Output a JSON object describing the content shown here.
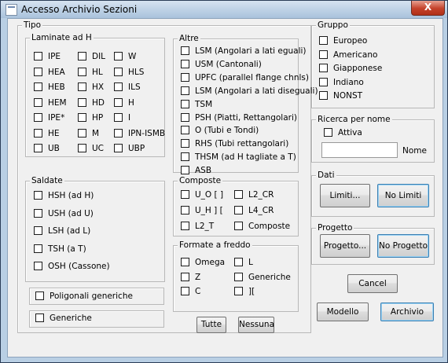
{
  "window": {
    "title": "Accesso Archivio Sezioni",
    "close": "X"
  },
  "tipo": {
    "label": "Tipo",
    "laminate": {
      "label": "Laminate ad H",
      "items": [
        "IPE",
        "DIL",
        "W",
        "HEA",
        "HL",
        "HLS",
        "HEB",
        "HX",
        "ILS",
        "HEM",
        "HD",
        "H",
        "IPE*",
        "HP",
        "I",
        "HE",
        "M",
        "IPN-ISMB",
        "UB",
        "UC",
        "UBP"
      ]
    },
    "altre": {
      "label": "Altre",
      "items": [
        "LSM (Angolari a lati eguali)",
        "USM (Cantonali)",
        "UPFC (parallel flange chnls)",
        "LSM (Angolari a lati diseguali)",
        "TSM",
        "PSH (Piatti, Rettangolari)",
        "O (Tubi e Tondi)",
        "RHS (Tubi rettangolari)",
        "THSM (ad H tagliate a T)",
        "ASB"
      ]
    },
    "saldate": {
      "label": "Saldate",
      "items": [
        "HSH (ad H)",
        "USH (ad U)",
        "LSH (ad L)",
        "TSH (a T)",
        "OSH (Cassone)"
      ]
    },
    "composte": {
      "label": "Composte",
      "items": [
        "U_O [ ]",
        "L2_CR",
        "U_H ] [",
        "L4_CR",
        "L2_T",
        "Composte"
      ]
    },
    "formate": {
      "label": "Formate a freddo",
      "items": [
        "Omega",
        "L",
        "Z",
        "Generiche",
        "C",
        "]["
      ]
    },
    "poligonali": "Poligonali generiche",
    "generiche": "Generiche",
    "tutte": "Tutte",
    "nessuna": "Nessuna"
  },
  "gruppo": {
    "label": "Gruppo",
    "items": [
      "Europeo",
      "Americano",
      "Giapponese",
      "Indiano",
      "NONST"
    ]
  },
  "ricerca": {
    "label": "Ricerca per nome",
    "attiva": "Attiva",
    "nome_value": "",
    "nome_label": "Nome"
  },
  "dati": {
    "label": "Dati",
    "limiti": "Limiti...",
    "no_limiti": "No Limiti"
  },
  "progetto": {
    "label": "Progetto",
    "progetto_btn": "Progetto...",
    "no_progetto": "No Progetto"
  },
  "actions": {
    "cancel": "Cancel",
    "modello": "Modello",
    "archivio": "Archivio"
  }
}
